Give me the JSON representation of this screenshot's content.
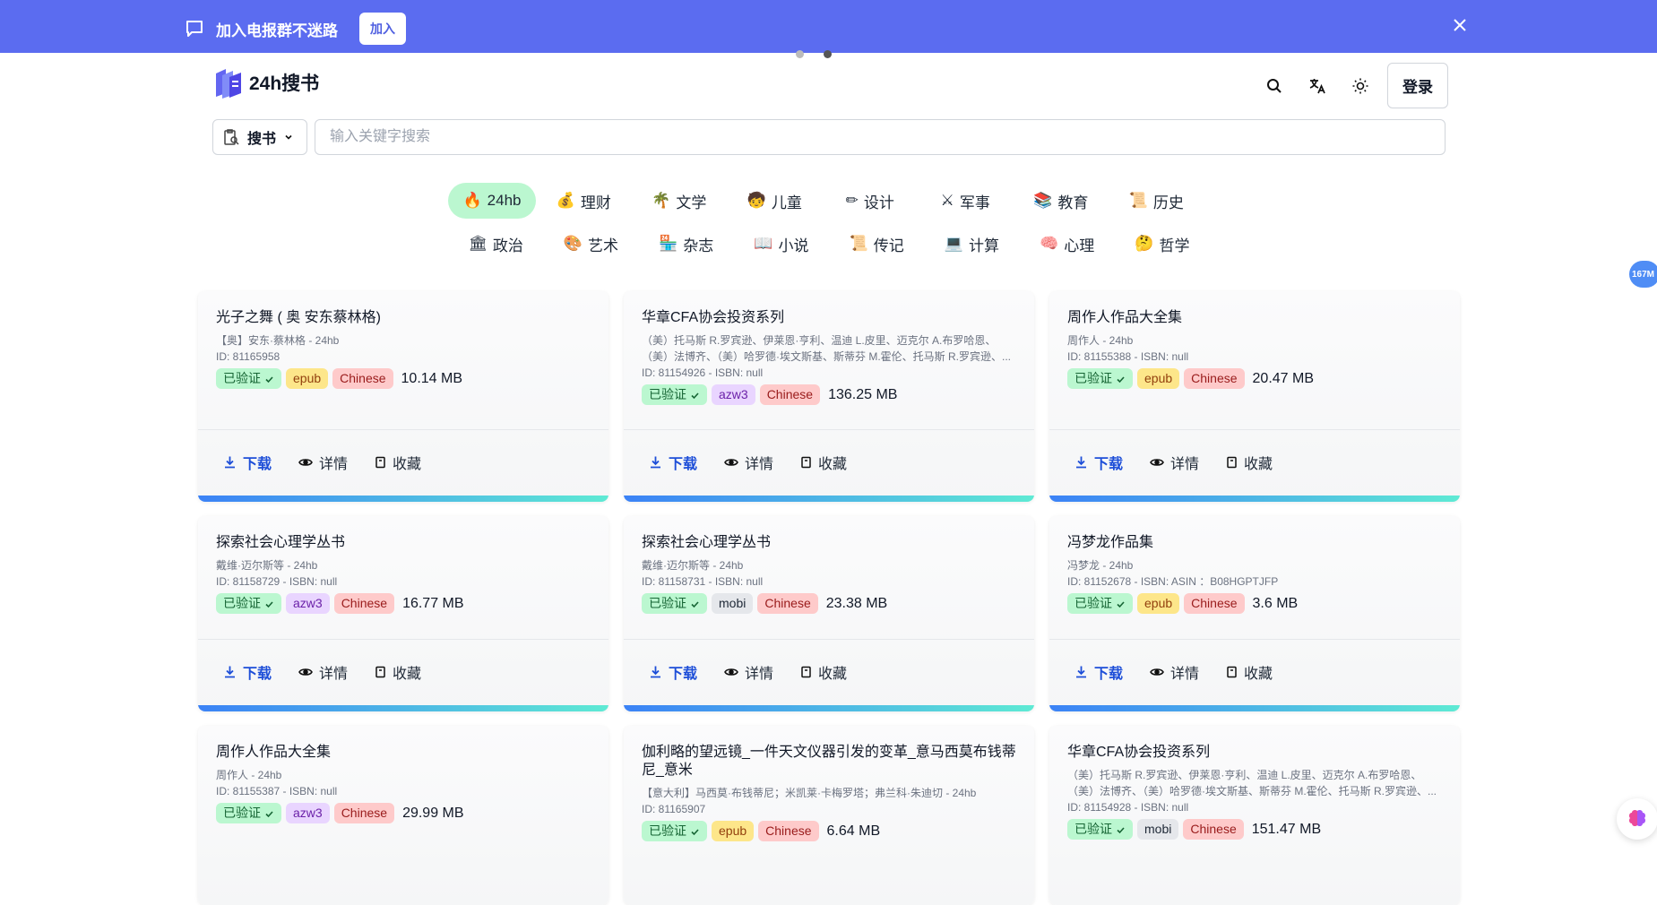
{
  "banner": {
    "text": "加入电报群不迷路",
    "join_label": "加入"
  },
  "header": {
    "logo_text": "24h搜书",
    "login_label": "登录"
  },
  "search": {
    "type_label": "搜书",
    "placeholder": "输入关键字搜索"
  },
  "categories_row1": [
    {
      "emoji": "🔥",
      "label": "24hb"
    },
    {
      "emoji": "💰",
      "label": "理财"
    },
    {
      "emoji": "🌴",
      "label": "文学"
    },
    {
      "emoji": "🧒",
      "label": "儿童"
    },
    {
      "emoji": "✏",
      "label": "设计"
    },
    {
      "emoji": "⚔",
      "label": "军事"
    },
    {
      "emoji": "📚",
      "label": "教育"
    },
    {
      "emoji": "📜",
      "label": "历史"
    }
  ],
  "categories_row2": [
    {
      "emoji": "🏛",
      "label": "政治"
    },
    {
      "emoji": "🎨",
      "label": "艺术"
    },
    {
      "emoji": "🏪",
      "label": "杂志"
    },
    {
      "emoji": "📖",
      "label": "小说"
    },
    {
      "emoji": "📜",
      "label": "传记"
    },
    {
      "emoji": "💻",
      "label": "计算"
    },
    {
      "emoji": "🧠",
      "label": "心理"
    },
    {
      "emoji": "🤔",
      "label": "哲学"
    }
  ],
  "side_badge": "167M",
  "actions": {
    "download": "下载",
    "detail": "详情",
    "favorite": "收藏"
  },
  "verified_label": "已验证",
  "books": [
    {
      "title": "光子之舞 ( 奥 安东蔡林格)",
      "sub1": "【奥】安东·蔡林格 - 24hb",
      "sub2": "",
      "id": "ID: 81165958",
      "format": "epub",
      "lang": "Chinese",
      "size": "10.14 MB"
    },
    {
      "title": "华章CFA协会投资系列",
      "sub1": "（美）托马斯 R.罗宾逊、伊莱恩·亨利、温迪 L.皮里、迈克尔 A.布罗哈恩、",
      "sub2": "（美）法博齐、（美）哈罗德·埃文斯基、斯蒂芬 M.霍伦、托马斯 R.罗宾逊、...",
      "id": "ID: 81154926 - ISBN: null",
      "format": "azw3",
      "lang": "Chinese",
      "size": "136.25 MB"
    },
    {
      "title": "周作人作品大全集",
      "sub1": "周作人 - 24hb",
      "sub2": "",
      "id": "ID: 81155388 - ISBN: null",
      "format": "epub",
      "lang": "Chinese",
      "size": "20.47 MB"
    },
    {
      "title": "探索社会心理学丛书",
      "sub1": "戴维·迈尔斯等 - 24hb",
      "sub2": "",
      "id": "ID: 81158729 - ISBN: null",
      "format": "azw3",
      "lang": "Chinese",
      "size": "16.77 MB"
    },
    {
      "title": "探索社会心理学丛书",
      "sub1": "戴维·迈尔斯等 - 24hb",
      "sub2": "",
      "id": "ID: 81158731 - ISBN: null",
      "format": "mobi",
      "lang": "Chinese",
      "size": "23.38 MB"
    },
    {
      "title": "冯梦龙作品集",
      "sub1": "冯梦龙 - 24hb",
      "sub2": "",
      "id": "ID: 81152678 - ISBN: ASIN ：B08HGPTJFP",
      "format": "epub",
      "lang": "Chinese",
      "size": "3.6 MB"
    },
    {
      "title": "周作人作品大全集",
      "sub1": "周作人 - 24hb",
      "sub2": "",
      "id": "ID: 81155387 - ISBN: null",
      "format": "azw3",
      "lang": "Chinese",
      "size": "29.99 MB"
    },
    {
      "title": "伽利略的望远镜_一件天文仪器引发的变革_意马西莫布钱蒂尼_意米",
      "sub1": "【意大利】马西莫·布钱蒂尼；米凯莱·卡梅罗塔；弗兰科·朱迪切 - 24hb",
      "sub2": "",
      "id": "ID: 81165907",
      "format": "epub",
      "lang": "Chinese",
      "size": "6.64 MB"
    },
    {
      "title": "华章CFA协会投资系列",
      "sub1": "（美）托马斯 R.罗宾逊、伊莱恩·亨利、温迪 L.皮里、迈克尔 A.布罗哈恩、",
      "sub2": "（美）法博齐、（美）哈罗德·埃文斯基、斯蒂芬 M.霍伦、托马斯 R.罗宾逊、...",
      "id": "ID: 81154928 - ISBN: null",
      "format": "mobi",
      "lang": "Chinese",
      "size": "151.47 MB"
    }
  ]
}
